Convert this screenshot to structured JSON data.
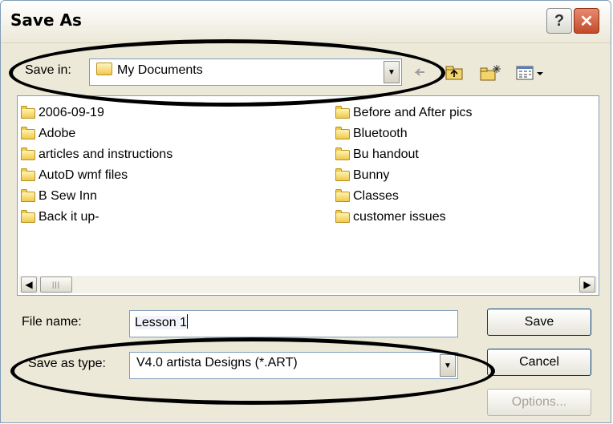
{
  "dialog": {
    "title": "Save As",
    "help_glyph": "?",
    "close_glyph": "✕"
  },
  "save_in": {
    "label": "Save in:",
    "value": "My Documents"
  },
  "files": [
    "2006-09-19",
    "Adobe",
    "articles and instructions",
    "AutoD wmf files",
    "B Sew Inn",
    "Back it up-",
    "Before and After pics",
    "Bluetooth",
    "Bu handout",
    "Bunny",
    "Classes",
    "customer issues"
  ],
  "file_name": {
    "label": "File name:",
    "value": "Lesson 1"
  },
  "save_as_type": {
    "label": "Save as type:",
    "value": "V4.0 artista Designs (*.ART)"
  },
  "buttons": {
    "save": "Save",
    "cancel": "Cancel",
    "options": "Options..."
  },
  "scroll": {
    "left_glyph": "◀",
    "right_glyph": "▶",
    "thumb_glyph": "|||"
  },
  "icons": [
    "folder-icon",
    "up-folder-icon",
    "new-folder-icon",
    "view-menu-icon",
    "back-arrow-icon"
  ],
  "colors": {
    "dialog_bg": "#ece9d8",
    "border": "#7f9db9",
    "close": "#c44a2a"
  }
}
